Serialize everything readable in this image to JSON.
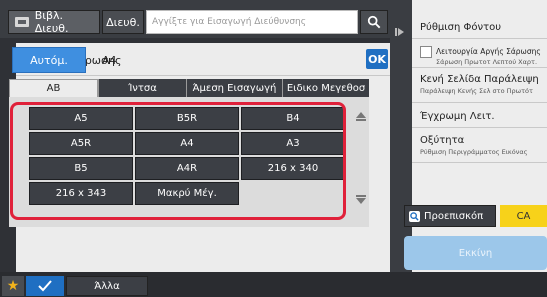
{
  "topbar": {
    "addressbook_label": "Βιβλ. Διευθ.",
    "address_label": "Διευθ.",
    "address_placeholder": "Αγγίξτε για Εισαγωγή Διεύθυνσης"
  },
  "panel": {
    "title": "Μέγεθ. Σάρωσης",
    "ok_label": "OK",
    "auto_label": "Αυτόμ.",
    "auto_value": "A4",
    "tabs": [
      "AB",
      "Ίντσα",
      "Άμεση Εισαγωγή",
      "Ειδικο Μεγεθοσ"
    ],
    "active_tab": 0,
    "sizes": [
      "A5",
      "B5R",
      "B4",
      "A5R",
      "A4",
      "A3",
      "B5",
      "A4R",
      "216 x 340",
      "216 x 343",
      "Μακρύ Μέγ."
    ]
  },
  "bottombar": {
    "other_label": "Άλλα"
  },
  "rightpanel": {
    "background_title": "Ρύθμιση Φόντου",
    "slow_scan_title": "Λειτουργία Αργής Σάρωσης",
    "slow_scan_sub": "Σάρωση Πρωτοτ Λεπτού Χαρτ.",
    "blank_page_title": "Κενή Σελίδα Παράλειψη",
    "blank_page_sub": "Παράλειψη Κενής Σελ στο Πρωτότ",
    "colour_title": "Έγχρωμη Λειτ.",
    "sharpness_title": "Οξύτητα",
    "sharpness_sub": "Ρύθμιση Περιγράμματος Εικόνας",
    "preview_label": "Προεπισκόπ",
    "ca_label": "CA",
    "start_label": "Εκκίνη"
  },
  "colors": {
    "accent_blue": "#1f6fc2",
    "highlight_red": "#e0213a",
    "ca_yellow": "#f7d21a"
  }
}
